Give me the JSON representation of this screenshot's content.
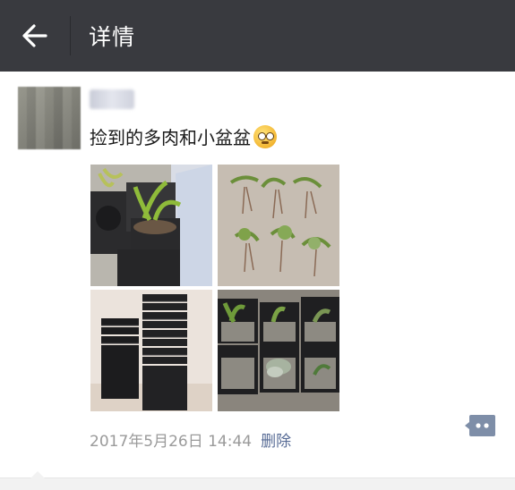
{
  "header": {
    "title": "详情",
    "back_icon": "arrow-left-icon",
    "background_color": "#393a3f"
  },
  "post": {
    "text": "捡到的多肉和小盆盆",
    "emoji": "flushed-face-emoji",
    "images": [
      "succulents-and-black-pots-photo",
      "succulent-cuttings-on-floor-photo",
      "stacked-black-pots-photo",
      "potted-succulents-photo"
    ],
    "timestamp": "2017年5月26日 14:44",
    "delete_label": "删除",
    "link_color": "#576b95",
    "comment_icon": "comment-bubble-icon"
  }
}
